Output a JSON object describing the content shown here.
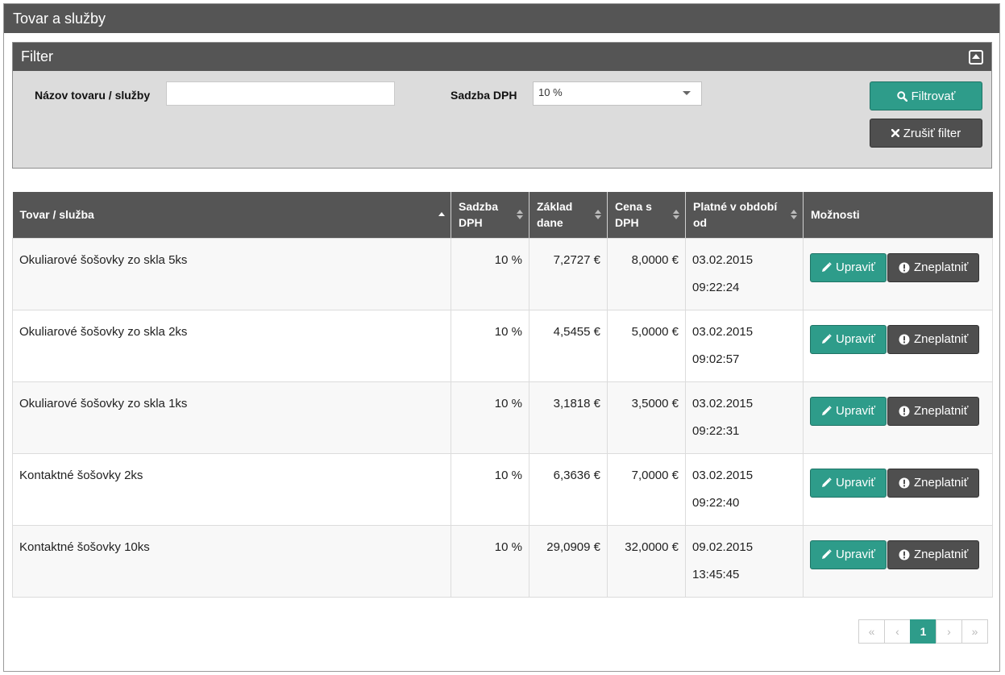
{
  "panel": {
    "title": "Tovar a služby"
  },
  "filter": {
    "title": "Filter",
    "name_label": "Názov tovaru / služby",
    "name_value": "",
    "vat_label": "Sadzba DPH",
    "vat_selected": "10 %",
    "filter_button": "Filtrovať",
    "cancel_button": "Zrušiť filter"
  },
  "table": {
    "columns": [
      "Tovar / služba",
      "Sadzba DPH",
      "Základ dane",
      "Cena s DPH",
      "Platné v období od",
      "Možnosti"
    ],
    "rows": [
      {
        "name": "Okuliarové šošovky zo skla 5ks",
        "vat": "10 %",
        "base": "7,2727 €",
        "price": "8,0000 €",
        "date": "03.02.2015",
        "time": "09:22:24"
      },
      {
        "name": "Okuliarové šošovky zo skla 2ks",
        "vat": "10 %",
        "base": "4,5455 €",
        "price": "5,0000 €",
        "date": "03.02.2015",
        "time": "09:02:57"
      },
      {
        "name": "Okuliarové šošovky zo skla 1ks",
        "vat": "10 %",
        "base": "3,1818 €",
        "price": "3,5000 €",
        "date": "03.02.2015",
        "time": "09:22:31"
      },
      {
        "name": "Kontaktné šošovky 2ks",
        "vat": "10 %",
        "base": "6,3636 €",
        "price": "7,0000 €",
        "date": "03.02.2015",
        "time": "09:22:40"
      },
      {
        "name": "Kontaktné šošovky 10ks",
        "vat": "10 %",
        "base": "29,0909 €",
        "price": "32,0000 €",
        "date": "09.02.2015",
        "time": "13:45:45"
      }
    ],
    "edit_label": "Upraviť",
    "invalidate_label": "Zneplatniť"
  },
  "pagination": {
    "first": "«",
    "prev": "‹",
    "current": "1",
    "next": "›",
    "last": "»"
  },
  "colors": {
    "header": "#555555",
    "accent": "#2e9c8a",
    "dark_button": "#4f4f4f",
    "filter_bg": "#dcdcdc"
  },
  "icons": [
    "collapse-icon",
    "search-icon",
    "close-icon",
    "sort-asc-icon",
    "sort-icon",
    "pencil-icon",
    "exclamation-icon"
  ]
}
